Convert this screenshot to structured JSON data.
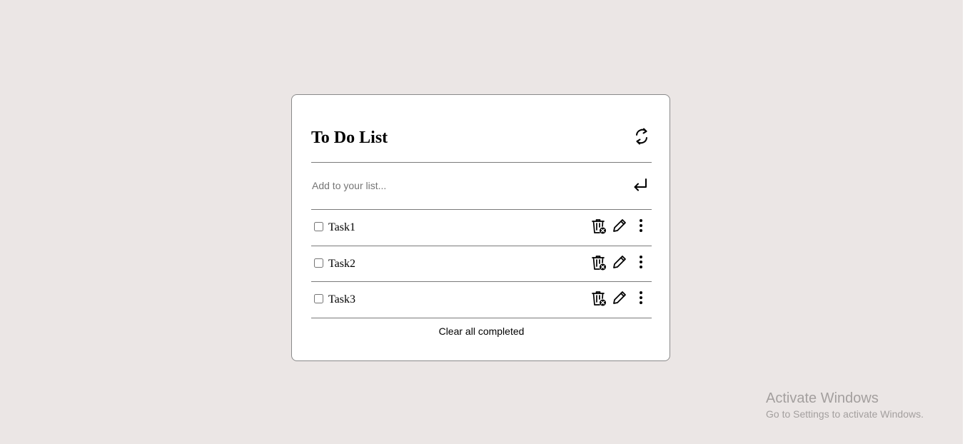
{
  "app": {
    "title": "To Do List"
  },
  "header": {
    "refresh_icon": "refresh-icon"
  },
  "add_form": {
    "placeholder": "Add to your list...",
    "value": "",
    "submit_icon": "enter-icon"
  },
  "tasks": [
    {
      "label": "Task1",
      "completed": false
    },
    {
      "label": "Task2",
      "completed": false
    },
    {
      "label": "Task3",
      "completed": false
    }
  ],
  "task_actions": {
    "delete_icon": "trash-icon",
    "edit_icon": "pencil-icon",
    "more_icon": "kebab-menu-icon"
  },
  "footer": {
    "clear_label": "Clear all completed"
  },
  "watermark": {
    "title": "Activate Windows",
    "subtitle": "Go to Settings to activate Windows."
  },
  "colors": {
    "background": "#ebe6e5",
    "card": "#ffffff",
    "divider": "#7a7a7a",
    "watermark": "#a39f9e"
  }
}
